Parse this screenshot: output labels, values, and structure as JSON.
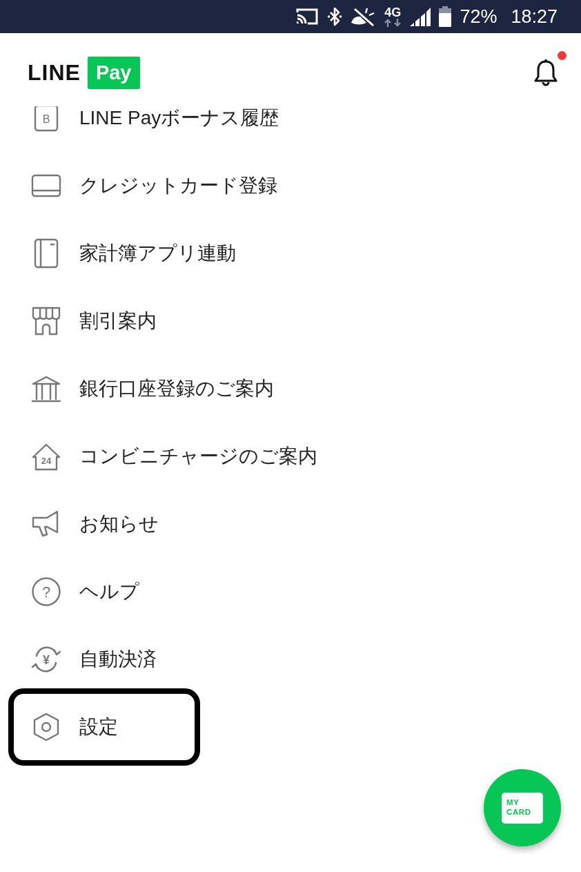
{
  "status_bar": {
    "network": "4G",
    "battery": "72%",
    "time": "18:27"
  },
  "header": {
    "logo_text": "LINE",
    "logo_badge": "Pay",
    "notifications": {
      "unread": true
    }
  },
  "menu": {
    "items": [
      {
        "kind": "bonus",
        "icon_text": "B",
        "label": "LINE Payボーナス履歴",
        "highlighted": false
      },
      {
        "kind": "card",
        "label": "クレジットカード登録",
        "highlighted": false
      },
      {
        "kind": "ledger",
        "label": "家計簿アプリ連動",
        "highlighted": false
      },
      {
        "kind": "shop",
        "label": "割引案内",
        "highlighted": false
      },
      {
        "kind": "bank",
        "label": "銀行口座登録のご案内",
        "highlighted": false
      },
      {
        "kind": "store",
        "icon_text": "24",
        "label": "コンビニチャージのご案内",
        "highlighted": false
      },
      {
        "kind": "notice",
        "label": "お知らせ",
        "highlighted": false
      },
      {
        "kind": "help",
        "icon_text": "?",
        "label": "ヘルプ",
        "highlighted": false
      },
      {
        "kind": "autopay",
        "icon_text": "¥",
        "label": "自動決済",
        "highlighted": false
      },
      {
        "kind": "settings",
        "label": "設定",
        "highlighted": true
      }
    ]
  },
  "fab": {
    "label": "MY CARD"
  }
}
